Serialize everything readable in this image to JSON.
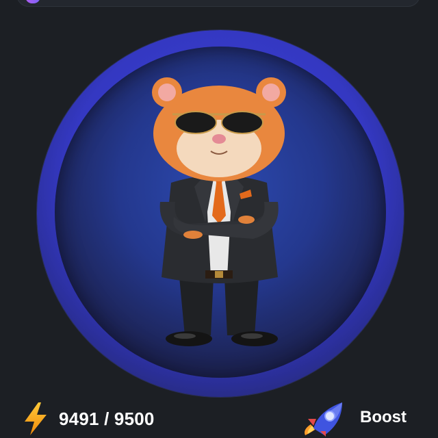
{
  "energy": {
    "current": "9491",
    "max": "9500",
    "display": "9491 / 9500",
    "icon": "lightning-icon"
  },
  "boost": {
    "label": "Boost",
    "icon": "rocket-icon"
  },
  "tap_target": {
    "character": "hamster-character",
    "accent": "#3d44d8"
  }
}
